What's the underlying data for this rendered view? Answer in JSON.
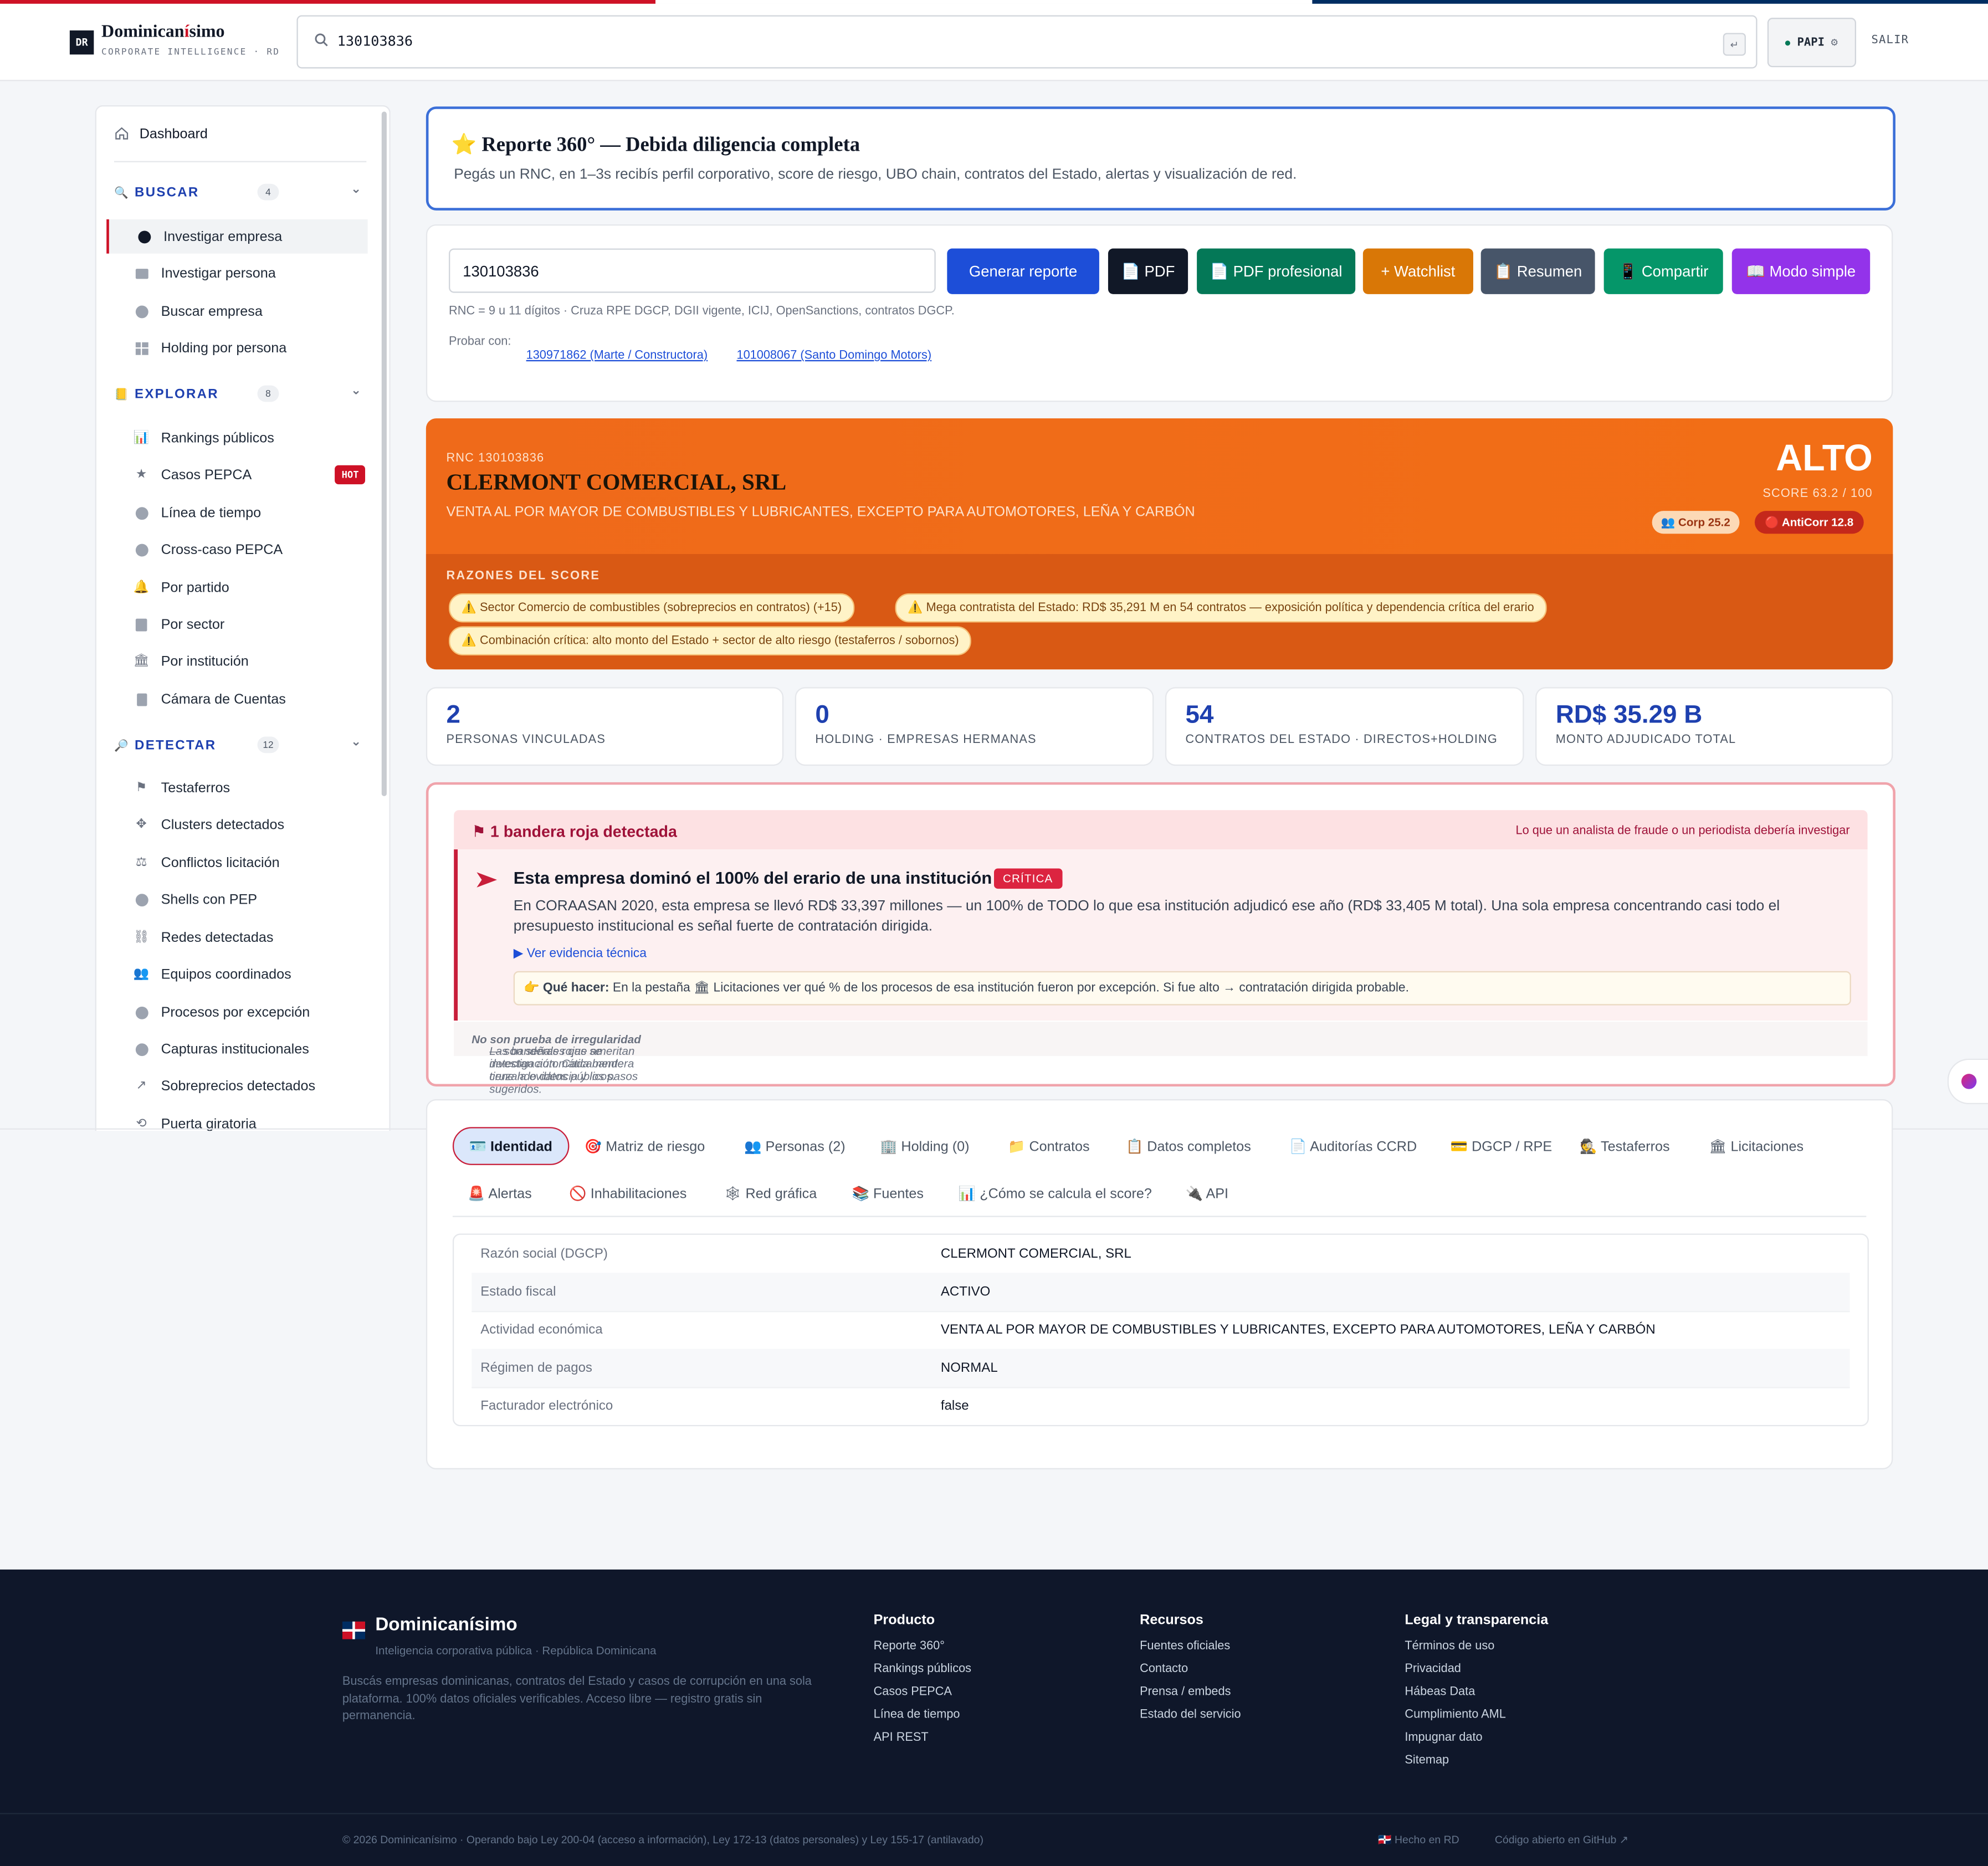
{
  "flag_colors": {
    "red": "#ce1126",
    "white": "#ffffff",
    "blue": "#002d62"
  },
  "header": {
    "logo": "DR",
    "brand_prefix": "Dominican",
    "brand_accent": "í",
    "brand_suffix": "simo",
    "brand_sub": "CORPORATE INTELLIGENCE · RD",
    "search_value": "130103836",
    "search_icon": "search-icon",
    "enter_glyph": "↵",
    "user": "PAPI",
    "logout": "SALIR"
  },
  "sidebar": {
    "dashboard": "Dashboard",
    "sections": [
      {
        "title": "BUSCAR",
        "count": "4",
        "items": [
          "Investigar empresa",
          "Investigar persona",
          "Buscar empresa",
          "Holding por persona"
        ]
      },
      {
        "title": "EXPLORAR",
        "count": "8",
        "items": [
          "Rankings públicos",
          "Casos PEPCA",
          "Línea de tiempo",
          "Cross-caso PEPCA",
          "Por partido",
          "Por sector",
          "Por institución",
          "Cámara de Cuentas"
        ]
      },
      {
        "title": "DETECTAR",
        "count": "12",
        "items": [
          "Testaferros",
          "Clusters detectados",
          "Conflictos licitación",
          "Shells con PEP",
          "Redes detectadas",
          "Equipos coordinados",
          "Procesos por excepción",
          "Capturas institucionales",
          "Sobreprecios detectados",
          "Puerta giratoria"
        ]
      }
    ],
    "hot_badge": "HOT",
    "active_item": "Investigar empresa"
  },
  "hero": {
    "title": "⭐ Reporte 360° — Debida diligencia completa",
    "desc": "Pegás un RNC, en 1–3s recibís perfil corporativo, score de riesgo, UBO chain, contratos del Estado, alertas y visualización de red."
  },
  "form": {
    "rnc_value": "130103836",
    "buttons": [
      {
        "label": "Generar reporte",
        "color": "#1d4ed8"
      },
      {
        "label": "📄 PDF",
        "color": "#111827"
      },
      {
        "label": "📄 PDF profesional",
        "color": "#047857"
      },
      {
        "label": "+ Watchlist",
        "color": "#d97706"
      },
      {
        "label": "📋 Resumen",
        "color": "#475569"
      },
      {
        "label": "📱 Compartir",
        "color": "#059669"
      },
      {
        "label": "📖 Modo simple",
        "color": "#9333ea"
      }
    ],
    "hint": "RNC = 9 u 11 dígitos · Cruza RPE DGCP, DGII vigente, ICIJ, OpenSanctions, contratos DGCP.",
    "probar": "Probar con:",
    "examples": [
      "130971862 (Marte / Constructora)",
      "101008067 (Santo Domingo Motors)"
    ]
  },
  "risk": {
    "rnc_label": "RNC 130103836",
    "company": "CLERMONT COMERCIAL, SRL",
    "activity": "VENTA AL POR MAYOR DE COMBUSTIBLES Y LUBRICANTES, EXCEPTO PARA AUTOMOTORES, LEÑA Y CARBÓN",
    "level": "ALTO",
    "score": "SCORE 63.2 / 100",
    "corp": "👥 Corp 25.2",
    "anticorr": "🔴 AntiCorr 12.8",
    "reasons_title": "RAZONES DEL SCORE",
    "reasons": [
      "⚠️ Sector Comercio de combustibles (sobreprecios en contratos) (+15)",
      "⚠️ Mega contratista del Estado: RD$ 35,291 M en 54 contratos — exposición política y dependencia crítica del erario",
      "⚠️ Combinación crítica: alto monto del Estado + sector de alto riesgo (testaferros / sobornos)"
    ]
  },
  "stats": [
    {
      "value": "2",
      "label": "PERSONAS VINCULADAS"
    },
    {
      "value": "0",
      "label": "HOLDING · EMPRESAS HERMANAS"
    },
    {
      "value": "54",
      "label": "CONTRATOS DEL ESTADO · DIRECTOS+HOLDING"
    },
    {
      "value": "RD$ 35.29 B",
      "label": "MONTO ADJUDICADO TOTAL"
    }
  ],
  "red_flags": {
    "header": "1 bandera roja detectada",
    "header_right": "Lo que un analista de fraude o un periodista debería investigar",
    "flag_title": "Esta empresa dominó el 100% del erario de una institución",
    "badge": "CRÍTICA",
    "desc": "En CORAASAN 2020, esta empresa se llevó RD$ 33,397 millones — un 100% de TODO lo que esa institución adjudicó ese año (RD$ 33,405 M total). Una sola empresa concentrando casi todo el presupuesto institucional es señal fuerte de contratación dirigida.",
    "evidence": "▶ Ver evidencia técnica",
    "que_hacer_label": "👉 Qué hacer:",
    "que_hacer": "En la pestaña 🏛 Licitaciones ver qué % de los procesos de esa institución fueron por excepción. Si fue alto → contratación dirigida probable.",
    "foot_a": "Las banderas rojas se detectan automáticamente cruzando datos públicos.",
    "foot_b": "No son prueba de irregularidad",
    "foot_c": "— son señales que ameritan investigación. Cada bandera tiene la evidencia y los pasos sugeridos."
  },
  "tabs": [
    "🪪 Identidad",
    "🎯 Matriz de riesgo",
    "👥 Personas (2)",
    "🏢 Holding (0)",
    "📁 Contratos",
    "📋 Datos completos",
    "📄 Auditorías CCRD",
    "💳 DGCP / RPE",
    "🕵 Testaferros",
    "🏛 Licitaciones",
    "🚨 Alertas",
    "🚫 Inhabilitaciones",
    "🕸 Red gráfica",
    "📚 Fuentes",
    "📊 ¿Cómo se calcula el score?",
    "🔌 API"
  ],
  "identity": [
    {
      "k": "Razón social (DGCP)",
      "v": "CLERMONT COMERCIAL, SRL"
    },
    {
      "k": "Estado fiscal",
      "v": "ACTIVO"
    },
    {
      "k": "Actividad económica",
      "v": "VENTA AL POR MAYOR DE COMBUSTIBLES Y LUBRICANTES, EXCEPTO PARA AUTOMOTORES, LEÑA Y CARBÓN"
    },
    {
      "k": "Régimen de pagos",
      "v": "NORMAL"
    },
    {
      "k": "Facturador electrónico",
      "v": "false"
    }
  ],
  "footer": {
    "brand": "Dominicanísimo",
    "sub": "Inteligencia corporativa pública · República Dominicana",
    "desc": "Buscás empresas dominicanas, contratos del Estado y casos de corrupción en una sola plataforma. 100% datos oficiales verificables. Acceso libre — registro gratis sin permanencia.",
    "columns": [
      {
        "title": "Producto",
        "links": [
          "Reporte 360°",
          "Rankings públicos",
          "Casos PEPCA",
          "Línea de tiempo",
          "API REST"
        ]
      },
      {
        "title": "Recursos",
        "links": [
          "Fuentes oficiales",
          "Contacto",
          "Prensa / embeds",
          "Estado del servicio"
        ]
      },
      {
        "title": "Legal y transparencia",
        "links": [
          "Términos de uso",
          "Privacidad",
          "Hábeas Data",
          "Cumplimiento AML",
          "Impugnar dato",
          "Sitemap"
        ]
      }
    ],
    "copyright": "© 2026 Dominicanísimo · Operando bajo Ley 200-04 (acceso a información), Ley 172-13 (datos personales) y Ley 155-17 (antilavado)",
    "made_in": "🇩🇴 Hecho en RD",
    "github": "Código abierto en GitHub ↗"
  }
}
